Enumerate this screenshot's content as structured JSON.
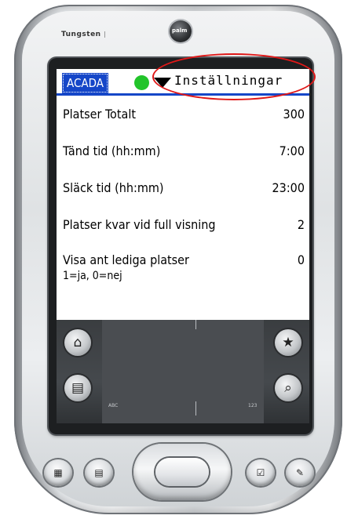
{
  "device": {
    "brand_text": "Tungsten",
    "brand_suffix": "|"
  },
  "screen": {
    "app_name": "ACADA",
    "title": "Inställningar",
    "status_color": "#22c42a",
    "accent_color": "#1546c8"
  },
  "settings": [
    {
      "label": "Platser Totalt",
      "value": "300"
    },
    {
      "label": "Tänd tid (hh:mm)",
      "value": "7:00"
    },
    {
      "label": "Släck tid (hh:mm)",
      "value": "23:00"
    },
    {
      "label": "Platser kvar vid full visning",
      "value": "2"
    },
    {
      "label": "Visa ant lediga platser",
      "sublabel": "1=ja, 0=nej",
      "value": "0"
    }
  ],
  "graffiti": {
    "left_label": "ABC",
    "right_label": "123",
    "icons": [
      "home-icon",
      "menu-icon",
      "star-icon",
      "search-icon"
    ]
  },
  "hardware_buttons": [
    "calendar-icon",
    "contacts-icon",
    "tasks-icon",
    "notes-icon"
  ],
  "annotation_color": "#e01818"
}
